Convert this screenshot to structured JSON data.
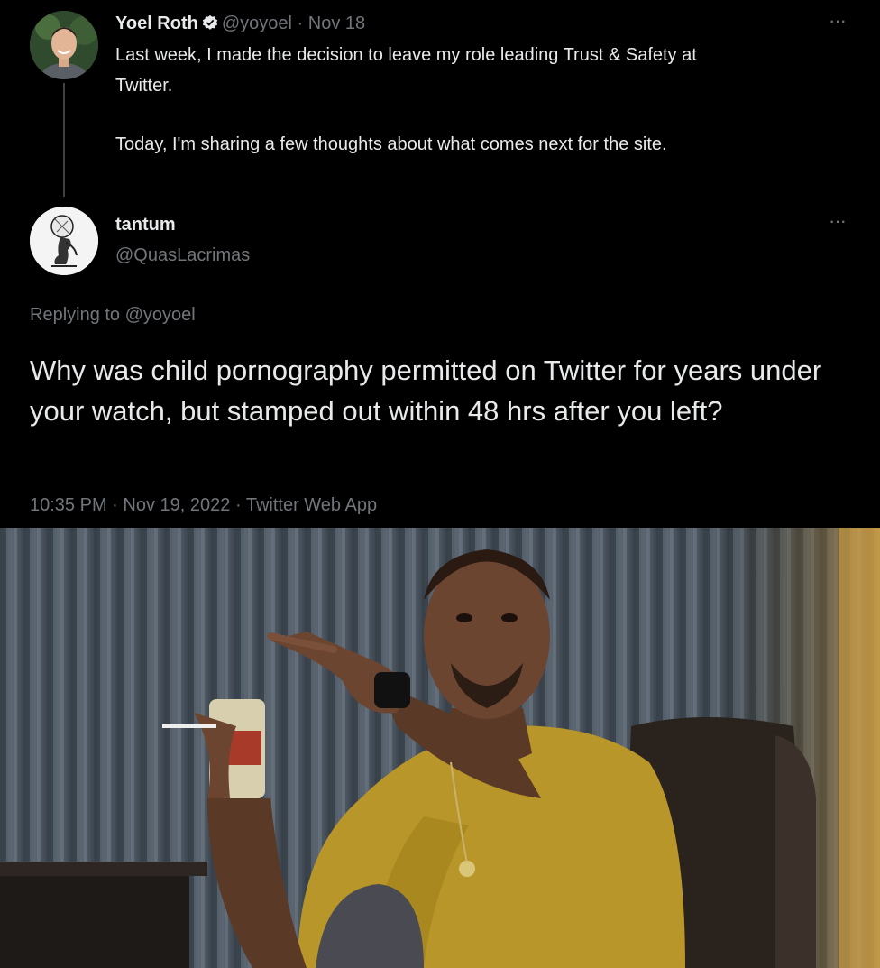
{
  "original_tweet": {
    "author_name": "Yoel Roth",
    "handle": "@yoyoel",
    "separator": "·",
    "date": "Nov 18",
    "text_line1": "Last week, I made the decision to leave my role leading Trust & Safety at",
    "text_line2": "Twitter.",
    "text_line3": "Today, I'm sharing a few thoughts about what comes next for the site.",
    "more_label": "···"
  },
  "reply_tweet": {
    "author_name": "tantum",
    "handle": "@QuasLacrimas",
    "replying_prefix": "Replying to",
    "replying_to": "@yoyoel",
    "text": "Why was child pornography permitted on Twitter for years under your watch, but stamped out within 48 hrs after you left?",
    "time": "10:35 PM",
    "date": "Nov 19, 2022",
    "source": "Twitter Web App",
    "separator": "·",
    "more_label": "···"
  },
  "colors": {
    "background": "#000000",
    "text_primary": "#e7e9ea",
    "text_muted": "#71767b",
    "verified_blue": "#1d9bf0"
  },
  "icons": [
    "verified-badge-icon",
    "more-options-icon"
  ]
}
